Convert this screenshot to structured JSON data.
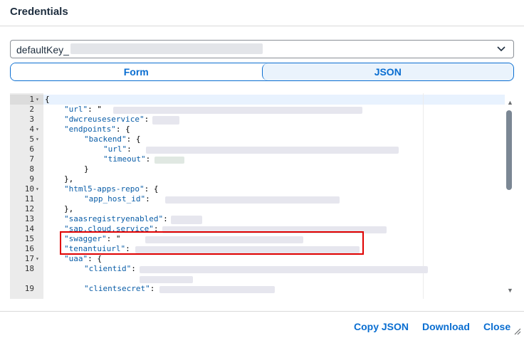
{
  "dialog": {
    "title": "Credentials"
  },
  "key_select": {
    "value": "defaultKey_"
  },
  "tabs": [
    {
      "label": "Form",
      "selected": false
    },
    {
      "label": "JSON",
      "selected": true
    }
  ],
  "editor": {
    "lines": [
      {
        "n": "1",
        "text": "{"
      },
      {
        "n": "2",
        "key": "\"url\"",
        "sep": ": \""
      },
      {
        "n": "3",
        "key": "\"dwcreuseservice\"",
        "sep": ": "
      },
      {
        "n": "4",
        "key": "\"endpoints\"",
        "sep": ": {"
      },
      {
        "n": "5",
        "key": "\"backend\"",
        "sep": ": {"
      },
      {
        "n": "6",
        "key": "\"url\"",
        "sep": ": "
      },
      {
        "n": "7",
        "key": "\"timeout\"",
        "sep": ": "
      },
      {
        "n": "8",
        "text": "}"
      },
      {
        "n": "9",
        "text": "},"
      },
      {
        "n": "10",
        "key": "\"html5-apps-repo\"",
        "sep": ": {"
      },
      {
        "n": "11",
        "key": "\"app_host_id\"",
        "sep": ": "
      },
      {
        "n": "12",
        "text": "},"
      },
      {
        "n": "13",
        "key": "\"saasregistryenabled\"",
        "sep": ": "
      },
      {
        "n": "14",
        "key": "\"sap.cloud.service\"",
        "sep": ": "
      },
      {
        "n": "15",
        "key": "\"swagger\"",
        "sep": ": \""
      },
      {
        "n": "16",
        "key": "\"tenantuiurl\"",
        "sep": ": "
      },
      {
        "n": "17",
        "key": "\"uaa\"",
        "sep": ": {"
      },
      {
        "n": "18",
        "key": "\"clientid\"",
        "sep": ": "
      },
      {
        "n": "19",
        "key": "\"clientsecret\"",
        "sep": ": "
      }
    ]
  },
  "footer": {
    "copy_json": "Copy JSON",
    "download": "Download",
    "close": "Close"
  },
  "colors": {
    "accent": "#0a6ed1",
    "highlight": "#e00000",
    "json_key": "#0b5ea8"
  }
}
